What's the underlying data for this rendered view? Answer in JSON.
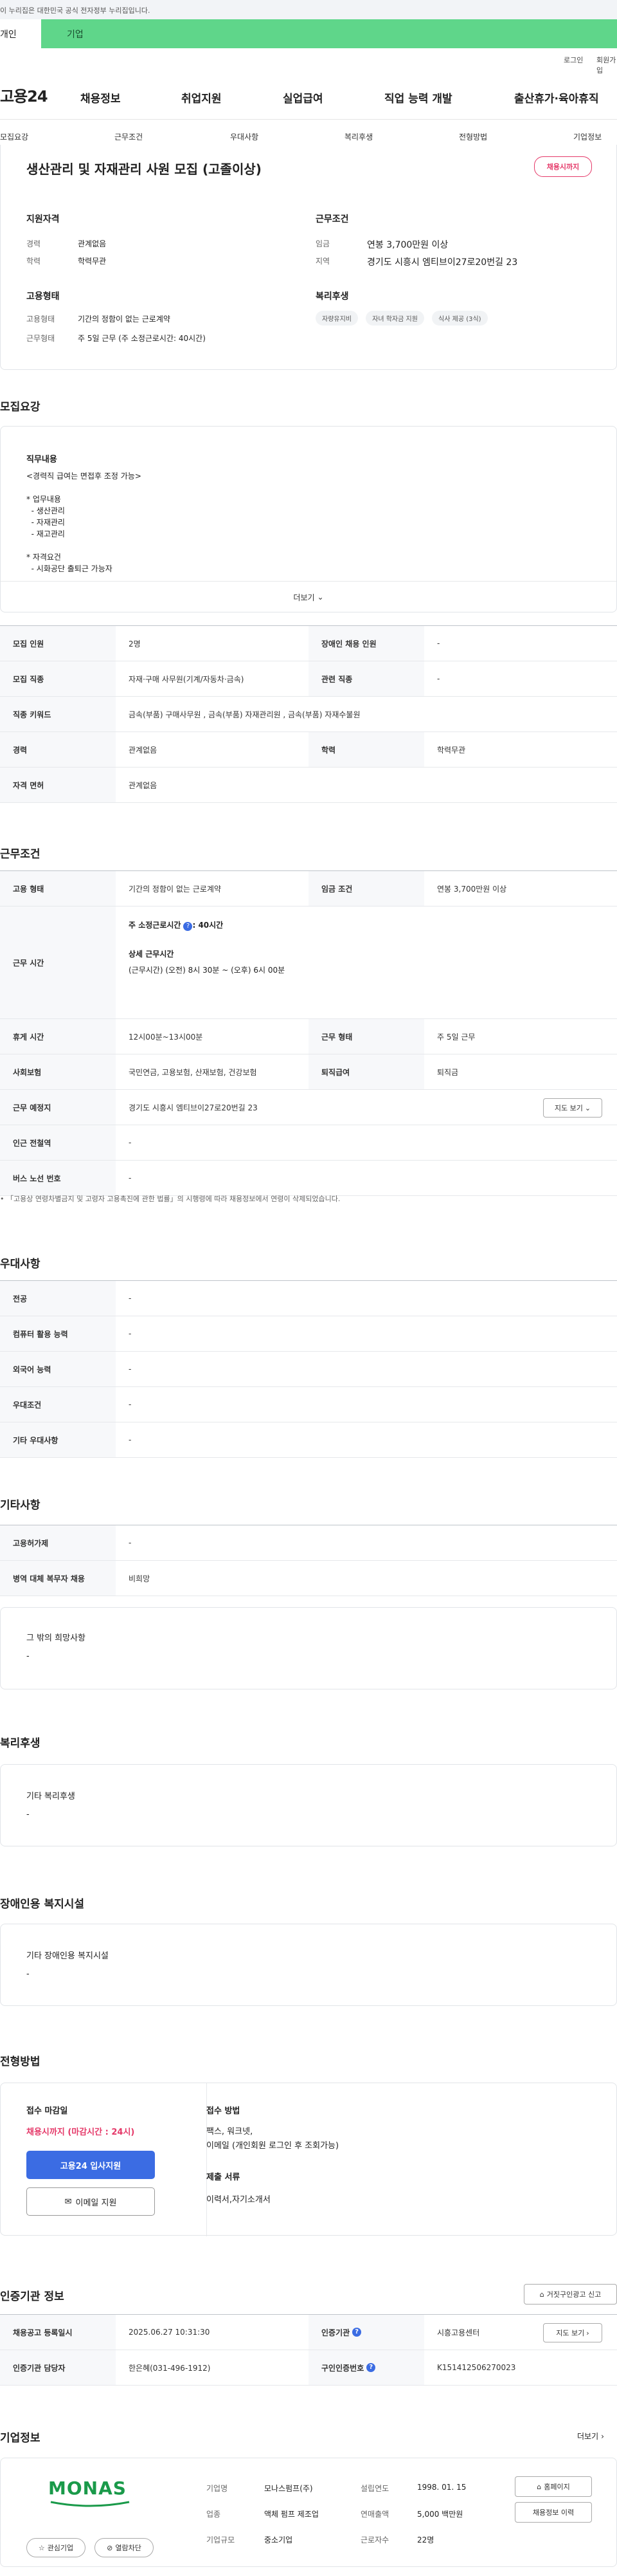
{
  "gov_banner": "이 누리집은 대한민국 공식 전자정부 누리집입니다.",
  "tabs": {
    "person": "개인",
    "company": "기업"
  },
  "util": {
    "login": "로그인",
    "join": "회원가입"
  },
  "logo": "고용24",
  "nav": [
    "채용정보",
    "취업지원",
    "실업급여",
    "직업 능력 개발",
    "출산휴가·육아휴직"
  ],
  "subnav": [
    "모집요강",
    "근무조건",
    "우대사항",
    "복리후생",
    "전형방법",
    "기업정보"
  ],
  "header": {
    "title": "생산관리 및 자재관리 사원 모집 (고졸이상)",
    "badge": "채용시까지",
    "qual_title": "지원자격",
    "career_label": "경력",
    "career_value": "관계없음",
    "edu_label": "학력",
    "edu_value": "학력무관",
    "work_title": "근무조건",
    "wage_label": "임금",
    "wage_value": "연봉 3,700만원 이상",
    "region_label": "지역",
    "region_value": "경기도 시흥시 엠티브이27로20번길 23",
    "emp_title": "고용형태",
    "emptype_label": "고용형태",
    "emptype_value": "기간의 정함이 없는 근로계약",
    "workform_label": "근무형태",
    "workform_value": "주 5일 근무 (주 소정근로시간: 40시간)",
    "welfare_title": "복리후생",
    "welfare_tags": [
      "자량유지비",
      "자녀 학자금 지원",
      "식사 제공 (3식)"
    ]
  },
  "recruit": {
    "section_title": "모집요강",
    "duty_title": "직무내용",
    "duty_lines": [
      "<경력직 급여는 면접후 조정 가능>",
      "",
      "* 업무내용",
      "  - 생산관리",
      "  - 자재관리",
      "  - 재고관리",
      "",
      "* 자격요건",
      "  - 시화공단 출퇴근 가능자"
    ],
    "more": "더보기"
  },
  "recruit_table": [
    {
      "h1": "모집 인원",
      "v1": "2명",
      "h2": "장애인 채용 인원",
      "v2": "-"
    },
    {
      "h1": "모집 직종",
      "v1": "자재·구매 사무원(기계/자동차·금속)",
      "h2": "관련 직종",
      "v2": "-"
    },
    {
      "h1": "직종 키워드",
      "v1": "금속(부품) 구매사무원 , 금속(부품) 자재관리원 , 금속(부품) 자재수불원",
      "h2": "",
      "v2": ""
    },
    {
      "h1": "경력",
      "v1": "관계없음",
      "h2": "학력",
      "v2": "학력무관"
    },
    {
      "h1": "자격 면허",
      "v1": "관계없음",
      "h2": "",
      "v2": ""
    }
  ],
  "work": {
    "section_title": "근무조건",
    "emp_h": "고용 형태",
    "emp_v": "기간의 정함이 없는 근로계약",
    "wage_h": "임금 조건",
    "wage_v": "연봉 3,700만원 이상",
    "hours_h": "근무 시간",
    "hours_weekly": "주 소정근로시간",
    "hours_weekly_value": ": 40시간",
    "hours_detail_title": "상세 근무시간",
    "hours_detail": "(근무시간) (오전) 8시 30분 ~ (오후) 6시 00분",
    "rest_h": "휴게 시간",
    "rest_v": "12시00분~13시00분",
    "form_h": "근무 형태",
    "form_v": "주 5일 근무",
    "ins_h": "사회보험",
    "ins_v": "국민연금, 고용보험, 산재보험, 건강보험",
    "sev_h": "퇴직급여",
    "sev_v": "퇴직금",
    "place_h": "근무 예정지",
    "place_v": "경기도 시흥시 엠티브이27로20번길 23",
    "map_btn": "지도 보기",
    "station_h": "인근 전철역",
    "station_v": "-",
    "bus_h": "버스 노선 번호",
    "bus_v": "-",
    "notice": "「고용상 연령차별금지 및 고령자 고용촉진에 관한 법률」의 시행령에 따라 채용정보에서 연령이 삭제되었습니다."
  },
  "prefer": {
    "section_title": "우대사항",
    "rows": [
      {
        "h": "전공",
        "v": "-"
      },
      {
        "h": "컴퓨터 활용 능력",
        "v": "-"
      },
      {
        "h": "외국어 능력",
        "v": "-"
      },
      {
        "h": "우대조건",
        "v": "-"
      },
      {
        "h": "기타 우대사항",
        "v": "-"
      }
    ]
  },
  "etc": {
    "section_title": "기타사항",
    "rows": [
      {
        "h": "고용허가제",
        "v": "-"
      },
      {
        "h": "병역 대체 복무자 채용",
        "v": "비희망"
      }
    ],
    "wish_title": "그 밖의 희망사항",
    "wish_value": "-"
  },
  "welfare": {
    "section_title": "복리후생",
    "box_title": "기타 복리후생",
    "box_value": "-"
  },
  "disabled": {
    "section_title": "장애인용 복지시설",
    "box_title": "기타 장애인용 복지시설",
    "box_value": "-"
  },
  "apply": {
    "section_title": "전형방법",
    "deadline_title": "접수 마감일",
    "deadline_value": "채용시까지 (마감시간 : 24시)",
    "apply_btn": "고용24 입사지원",
    "email_btn": "이메일 지원",
    "method_title": "접수 방법",
    "method_lines": [
      "팩스, 워크넷,",
      "이메일 (개인회원 로그인 후 조회가능)"
    ],
    "docs_title": "제출 서류",
    "docs_value": "이력서,자기소개서"
  },
  "agency": {
    "section_title": "인증기관 정보",
    "report_btn": "거짓구인광고 신고",
    "rows": [
      {
        "h1": "채용공고 등록일시",
        "v1": "2025.06.27 10:31:30",
        "h2": "인증기관",
        "v2": "시흥고용센터"
      },
      {
        "h1": "인증기관 담당자",
        "v1": "한은혜(031-496-1912)",
        "h2": "구인인증번호",
        "v2": "K151412506270023"
      }
    ],
    "map_btn": "지도 보기"
  },
  "company": {
    "section_title": "기업정보",
    "more": "더보기",
    "logo_text": "MONAS",
    "fav_btn": "관심기업",
    "block_btn": "열람차단",
    "name_label": "기업명",
    "name_value": "모나스펌프(주)",
    "industry_label": "업종",
    "industry_value": "액체 펌프 제조업",
    "size_label": "기업규모",
    "size_value": "중소기업",
    "est_label": "설립연도",
    "est_value": "1998. 01. 15",
    "sales_label": "연매출액",
    "sales_value": "5,000 백만원",
    "emp_label": "근로자수",
    "emp_value": "22명",
    "home_btn": "홈페이지",
    "list_btn": "채용정보 이력"
  },
  "colors": {
    "accent_green": "#5fd68a",
    "brand_red": "#e53969",
    "primary_blue": "#3b6ce3"
  }
}
